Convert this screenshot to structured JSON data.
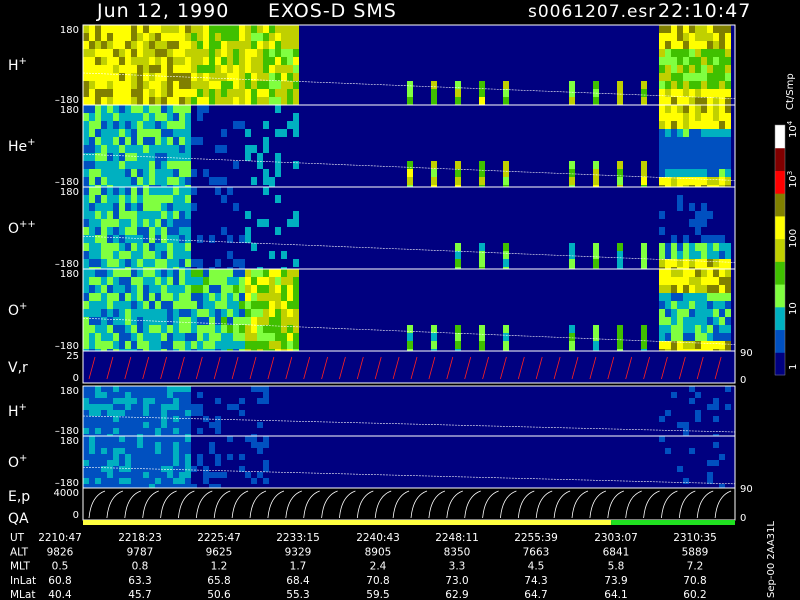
{
  "header": {
    "date": "Jun 12, 1990",
    "mission": "EXOS-D SMS",
    "file": "s0061207.esr",
    "time": "22:10:47"
  },
  "colorbar": {
    "unit": "Ct/Smp",
    "tick_labels": [
      "1",
      "10",
      "100",
      "10",
      "10"
    ],
    "exponents": [
      "",
      "",
      "",
      "3",
      "4"
    ],
    "colors": [
      "#000080",
      "#0050c0",
      "#00b0c0",
      "#80ff40",
      "#40c000",
      "#c0d000",
      "#ffff00",
      "#808000",
      "#ff0000",
      "#800000",
      "#ffffff"
    ]
  },
  "panels": [
    {
      "label": "H",
      "sup": "+",
      "top": "180",
      "bottom": "–180"
    },
    {
      "label": "He",
      "sup": "+",
      "top": "180",
      "bottom": "–180"
    },
    {
      "label": "O",
      "sup": "++",
      "top": "180",
      "bottom": "–180"
    },
    {
      "label": "O",
      "sup": "+",
      "top": "180",
      "bottom": "–180"
    },
    {
      "label": "V,r",
      "sup": "",
      "top": "25",
      "bottom": "0"
    },
    {
      "label": "H",
      "sup": "+",
      "top": "180",
      "bottom": "–180"
    },
    {
      "label": "O",
      "sup": "+",
      "top": "180",
      "bottom": "–180"
    },
    {
      "label": "E,p",
      "sup": "",
      "top": "4000",
      "bottom": "0"
    }
  ],
  "right_axis": {
    "vr_top": "90",
    "vr_bottom": "0",
    "ep_top": "90",
    "ep_bottom": "0"
  },
  "qa_label": "QA",
  "side_label": "Sep-00  2AA31L",
  "chart_data": {
    "type": "heatmap",
    "title": "Jun 12, 1990   EXOS-D SMS   s0061207.esr   22:10:47",
    "xlabel": "UT",
    "x_ticks": [
      "2210:47",
      "2218:23",
      "2225:47",
      "2233:15",
      "2240:43",
      "2248:11",
      "2255:39",
      "2303:07",
      "2310:35"
    ],
    "ylim_pitch": [
      -180,
      180
    ],
    "ylim_vr": [
      0,
      25
    ],
    "ylim_ep": [
      0,
      4000
    ],
    "zlabel": "Ct/Smp",
    "zscale": "log",
    "zlim": [
      1,
      10000
    ]
  },
  "table": {
    "rows": [
      {
        "name": "UT",
        "values": [
          "2210:47",
          "2218:23",
          "2225:47",
          "2233:15",
          "2240:43",
          "2248:11",
          "2255:39",
          "2303:07",
          "2310:35"
        ]
      },
      {
        "name": "ALT",
        "values": [
          "9826",
          "9787",
          "9625",
          "9329",
          "8905",
          "8350",
          "7663",
          "6841",
          "5889"
        ]
      },
      {
        "name": "MLT",
        "values": [
          "0.5",
          "0.8",
          "1.2",
          "1.7",
          "2.4",
          "3.3",
          "4.5",
          "5.8",
          "7.2"
        ]
      },
      {
        "name": "InLat",
        "values": [
          "60.8",
          "63.3",
          "65.8",
          "68.4",
          "70.8",
          "73.0",
          "74.3",
          "73.9",
          "70.8"
        ]
      },
      {
        "name": "MLat",
        "values": [
          "40.4",
          "45.7",
          "50.6",
          "55.3",
          "59.5",
          "62.9",
          "64.7",
          "64.1",
          "60.2"
        ]
      }
    ]
  }
}
